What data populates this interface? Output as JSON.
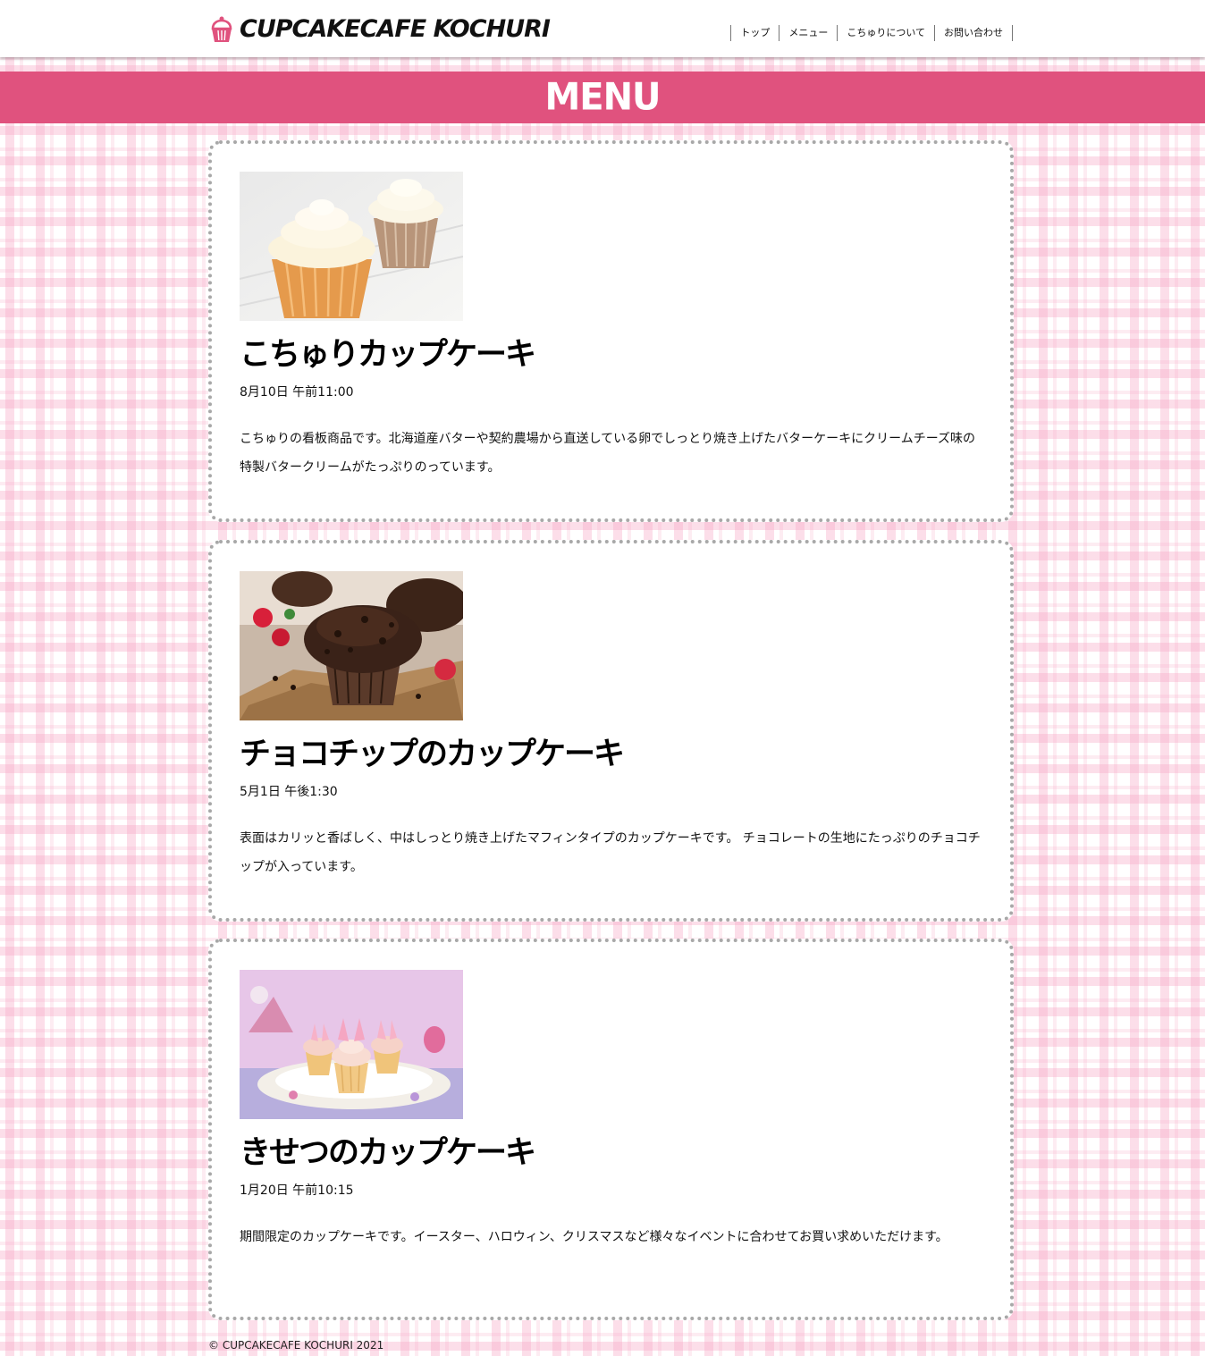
{
  "header": {
    "logo_text": "CUPCAKECAFE KOCHURI",
    "nav": [
      {
        "label": "トップ"
      },
      {
        "label": "メニュー"
      },
      {
        "label": "こちゅりについて"
      },
      {
        "label": "お問い合わせ"
      }
    ]
  },
  "banner": {
    "title": "MENU"
  },
  "menu_items": [
    {
      "title": "こちゅりカップケーキ",
      "date": "8月10日 午前11:00",
      "description": "こちゅりの看板商品です。北海道産バターや契約農場から直送している卵でしっとり焼き上げたバターケーキにクリームチーズ味の特製バタークリームがたっぷりのっています。"
    },
    {
      "title": "チョコチップのカップケーキ",
      "date": "5月1日 午後1:30",
      "description": "表面はカリッと香ばしく、中はしっとり焼き上げたマフィンタイプのカップケーキです。 チョコレートの生地にたっぷりのチョコチップが入っています。"
    },
    {
      "title": "きせつのカップケーキ",
      "date": "1月20日 午前10:15",
      "description": "期間限定のカップケーキです。イースター、ハロウィン、クリスマスなど様々なイベントに合わせてお買い求めいただけます。"
    }
  ],
  "footer": {
    "copyright": "© CUPCAKECAFE KOCHURI 2021"
  },
  "colors": {
    "accent": "#e0527e",
    "logo_icon": "#e0527e",
    "card_border": "#a8a8a8",
    "check_pattern": "#f7a8c6"
  },
  "icons": {
    "logo": "cupcake-icon"
  }
}
